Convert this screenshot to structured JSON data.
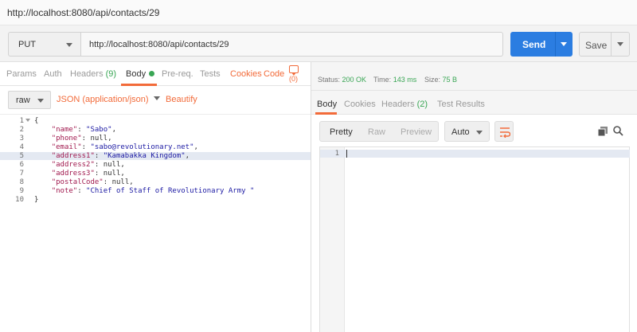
{
  "window": {
    "title": "http://localhost:8080/api/contacts/29"
  },
  "request": {
    "method": "PUT",
    "url": "http://localhost:8080/api/contacts/29",
    "send_label": "Send",
    "save_label": "Save"
  },
  "request_tabs": {
    "params": "Params",
    "auth": "Auth",
    "headers": "Headers",
    "headers_count": "(9)",
    "body": "Body",
    "prereq": "Pre-req.",
    "tests": "Tests",
    "cookies": "Cookies",
    "code": "Code",
    "comments_count": "(0)"
  },
  "body_options": {
    "mode": "raw",
    "content_type": "JSON (application/json)",
    "beautify": "Beautify"
  },
  "editor": {
    "highlighted_line": 5,
    "lines": [
      {
        "n": "1",
        "fold": true
      },
      {
        "n": "2"
      },
      {
        "n": "3"
      },
      {
        "n": "4"
      },
      {
        "n": "5"
      },
      {
        "n": "6"
      },
      {
        "n": "7"
      },
      {
        "n": "8"
      },
      {
        "n": "9"
      },
      {
        "n": "10"
      }
    ],
    "code": {
      "l1": "{",
      "l2_key": "\"name\"",
      "l2_val": "\"Sabo\"",
      "l3_key": "\"phone\"",
      "l3_val": "null",
      "l4_key": "\"email\"",
      "l4_val": "\"sabo@revolutionary.net\"",
      "l5_key": "\"address1\"",
      "l5_val": "\"Kamabakka Kingdom\"",
      "l6_key": "\"address2\"",
      "l6_val": "null",
      "l7_key": "\"address3\"",
      "l7_val": "null",
      "l8_key": "\"postalCode\"",
      "l8_val": "null",
      "l9_key": "\"note\"",
      "l9_val": "\"Chief of Staff of Revolutionary Army \"",
      "l10": "}"
    }
  },
  "response_status": {
    "status_label": "Status:",
    "status_value": "200 OK",
    "time_label": "Time:",
    "time_value": "143 ms",
    "size_label": "Size:",
    "size_value": "75 B"
  },
  "response_tabs": {
    "body": "Body",
    "cookies": "Cookies",
    "headers": "Headers",
    "headers_count": "(2)",
    "test_results": "Test Results"
  },
  "response_view": {
    "pretty": "Pretty",
    "raw": "Raw",
    "preview": "Preview",
    "format": "Auto",
    "line_1": "1"
  },
  "colors": {
    "accent": "#f26b3a",
    "send": "#2b7de1",
    "ok_green": "#3aa655"
  },
  "icons": {
    "wrap": "wrap-lines-icon",
    "copy": "copy-icon",
    "search": "search-icon",
    "comment": "comment-icon"
  }
}
